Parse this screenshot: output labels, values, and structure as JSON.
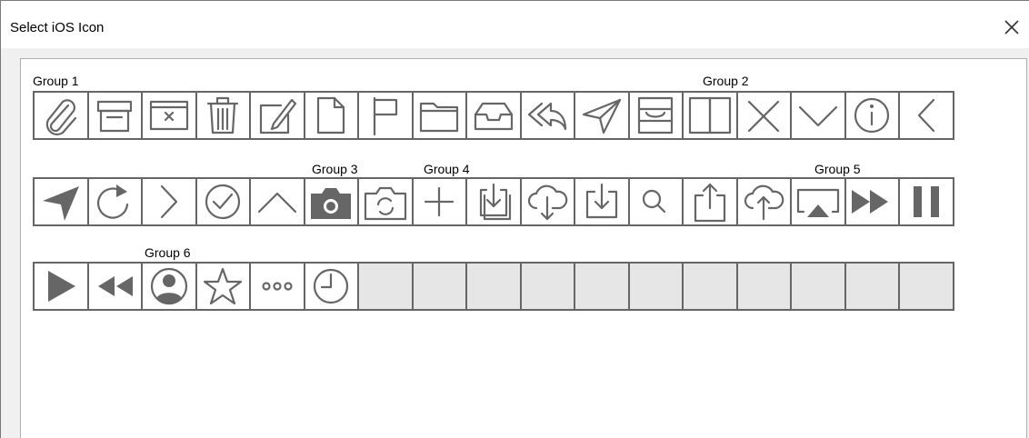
{
  "window": {
    "title": "Select iOS Icon",
    "close_icon": "close-icon"
  },
  "groups": {
    "g1": "Group 1",
    "g2": "Group 2",
    "g3": "Group 3",
    "g4": "Group 4",
    "g5": "Group 5",
    "g6": "Group 6"
  },
  "rows": [
    [
      "paperclip-icon",
      "archive-box-icon",
      "delete-tray-icon",
      "trash-icon",
      "compose-icon",
      "document-icon",
      "flag-icon",
      "folder-icon",
      "inbox-icon",
      "reply-all-icon",
      "send-icon",
      "archive-drawer-icon",
      "book-icon",
      "close-x-icon",
      "chevron-down-icon",
      "info-icon",
      "chevron-left-icon"
    ],
    [
      "location-arrow-icon",
      "refresh-icon",
      "chevron-right-icon",
      "check-circle-icon",
      "chevron-up-icon",
      "camera-icon",
      "switch-camera-icon",
      "plus-icon",
      "copy-download-icon",
      "cloud-download-icon",
      "download-icon",
      "search-icon",
      "share-icon",
      "cloud-upload-icon",
      "airplay-icon",
      "fast-forward-icon",
      "pause-icon"
    ],
    [
      "play-icon",
      "rewind-icon",
      "user-circle-icon",
      "star-icon",
      "more-icon",
      "clock-icon",
      "",
      "",
      "",
      "",
      "",
      "",
      "",
      "",
      "",
      "",
      ""
    ]
  ],
  "colors": {
    "icon_stroke": "#666666",
    "icon_fill": "#666666",
    "empty_cell": "#e6e6e6"
  }
}
